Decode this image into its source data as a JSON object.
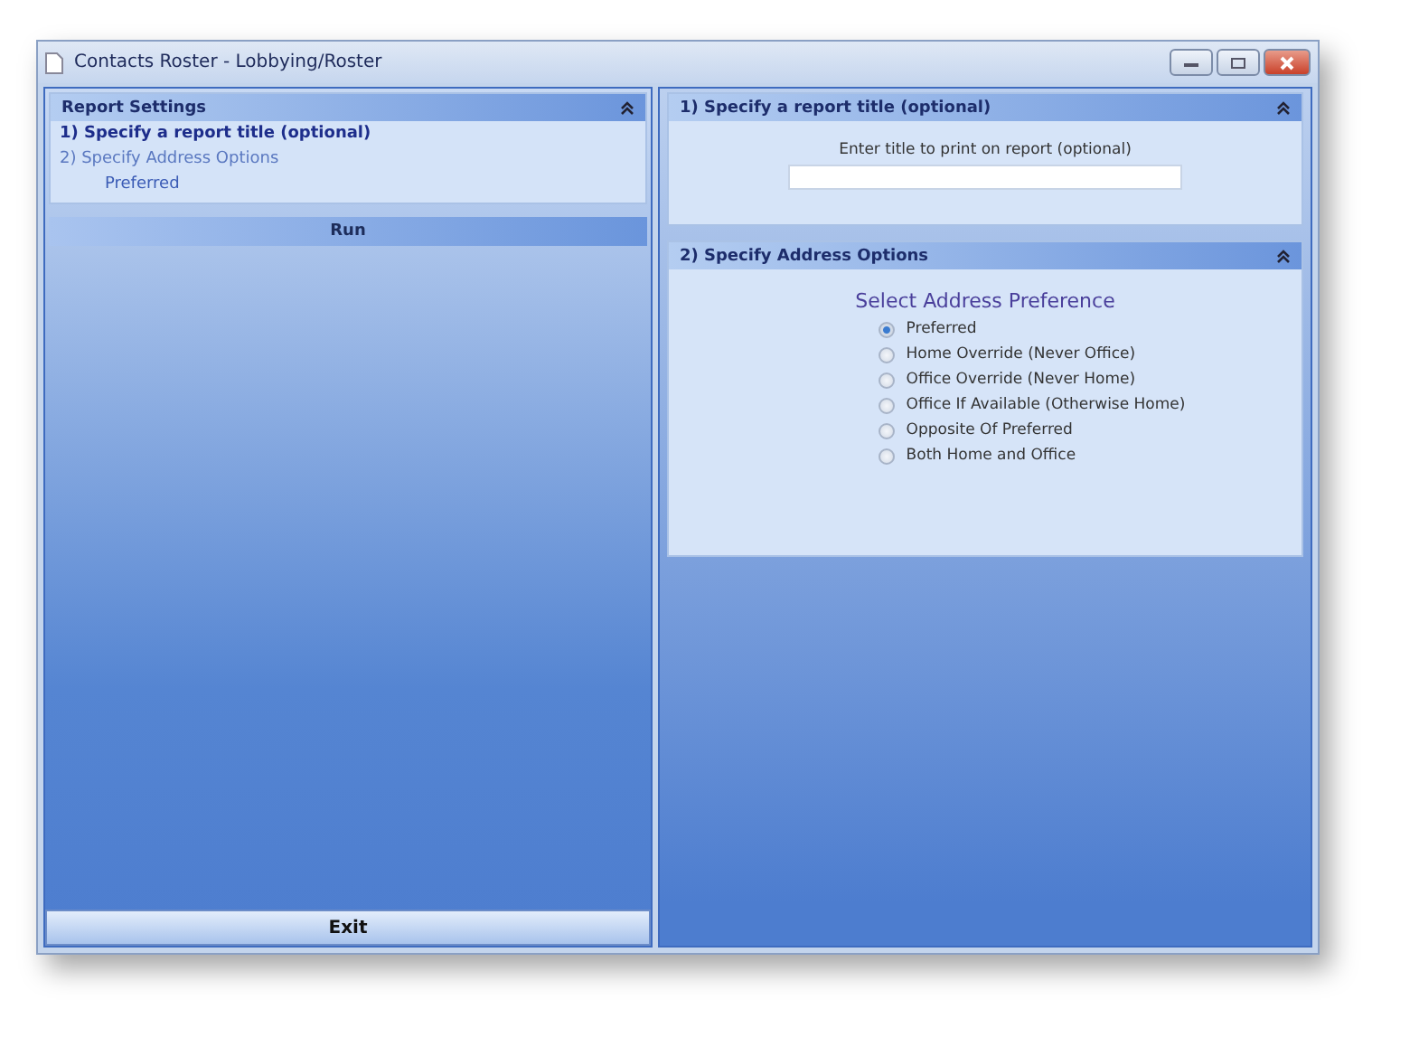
{
  "window": {
    "title": "Contacts Roster - Lobbying/Roster"
  },
  "report_settings": {
    "title": "Report Settings",
    "items": [
      {
        "label": "1)  Specify a report title (optional)",
        "selected": true
      },
      {
        "label": "2)  Specify Address Options",
        "selected": false,
        "value": "Preferred"
      }
    ],
    "run_button": "Run"
  },
  "exit_button": "Exit",
  "title_section": {
    "title": "1)  Specify a report title (optional)",
    "field_label": "Enter title to print on report (optional)"
  },
  "address_section": {
    "title": "2)  Specify Address Options",
    "heading": "Select Address Preference",
    "options": [
      {
        "label": "Preferred",
        "selected": true
      },
      {
        "label": "Home Override (Never Office)",
        "selected": false
      },
      {
        "label": "Office Override (Never Home)",
        "selected": false
      },
      {
        "label": "Office If Available (Otherwise Home)",
        "selected": false
      },
      {
        "label": "Opposite Of Preferred",
        "selected": false
      },
      {
        "label": "Both Home and Office",
        "selected": false
      }
    ]
  }
}
